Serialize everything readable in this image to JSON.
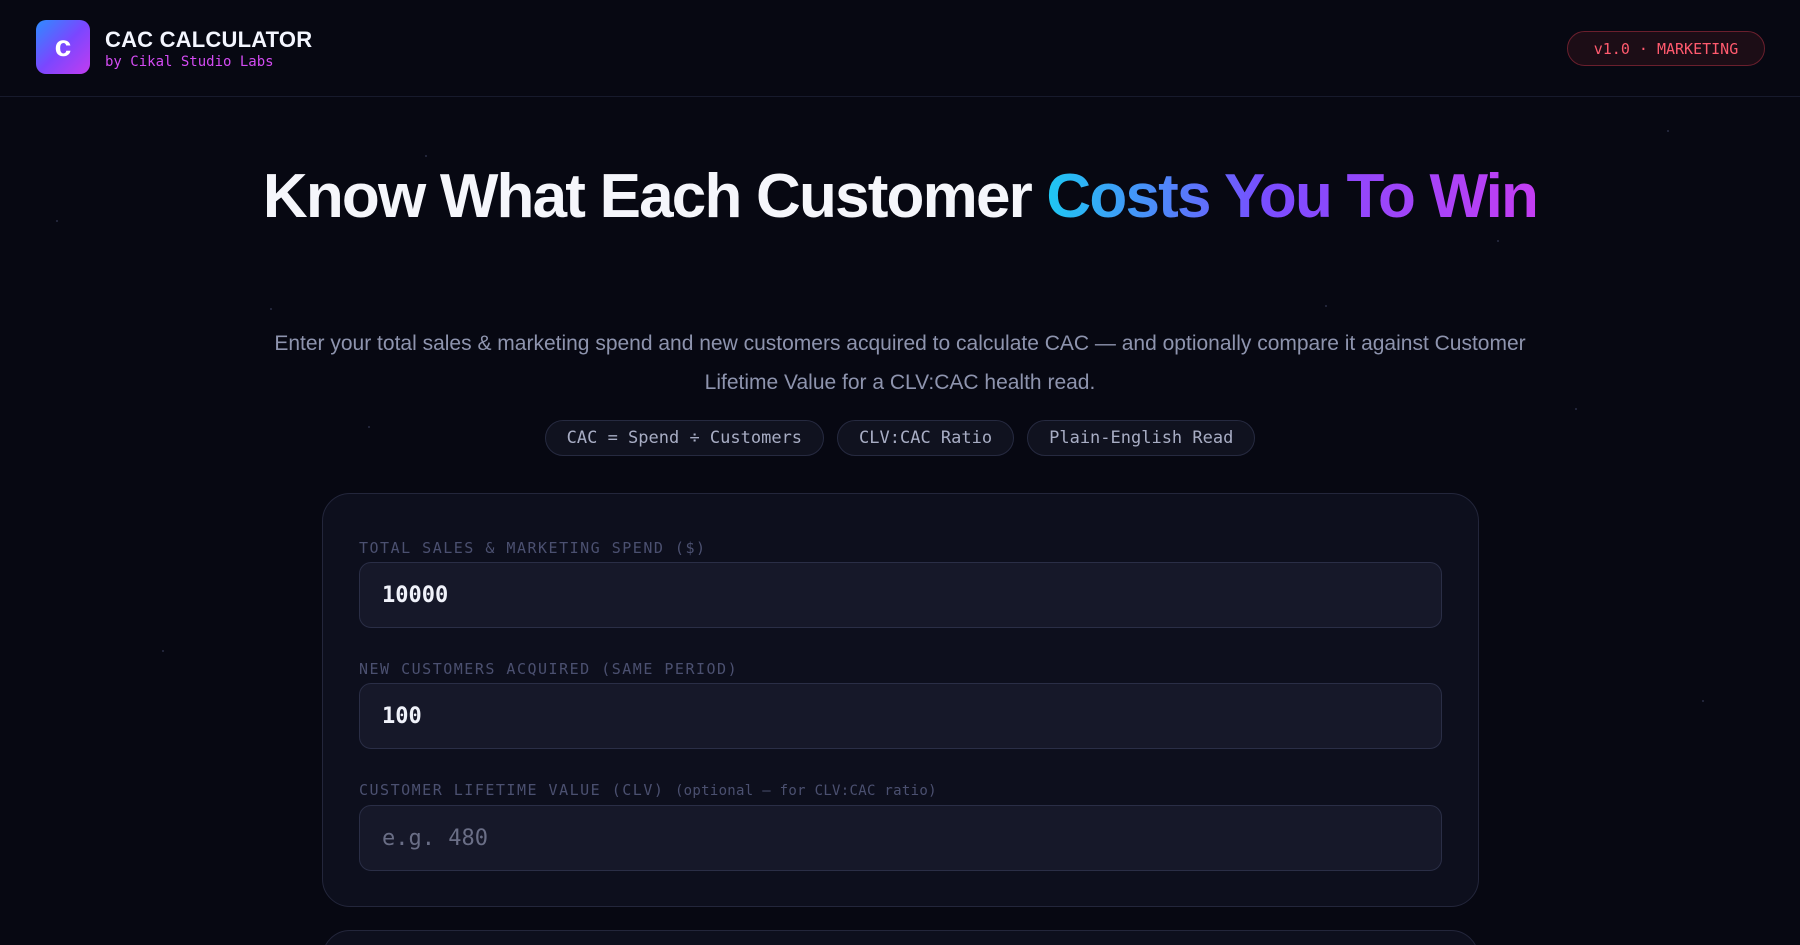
{
  "header": {
    "logo_letter": "c",
    "app_title": "CAC CALCULATOR",
    "app_subtitle": "by Cikal Studio Labs",
    "version_badge": "v1.0 · MARKETING"
  },
  "hero": {
    "title_plain": "Know What Each Customer ",
    "title_accent": "Costs You To Win",
    "subtitle": "Enter your total sales & marketing spend and new customers acquired to calculate CAC — and optionally compare it against Customer Lifetime Value for a CLV:CAC health read.",
    "chips": [
      "CAC = Spend ÷ Customers",
      "CLV:CAC Ratio",
      "Plain-English Read"
    ]
  },
  "form": {
    "spend_label": "TOTAL SALES & MARKETING SPEND ($)",
    "spend_value": "10000",
    "customers_label": "NEW CUSTOMERS ACQUIRED (SAME PERIOD)",
    "customers_value": "100",
    "clv_label": "CUSTOMER LIFETIME VALUE (CLV)",
    "clv_optional_note": "(optional — for CLV:CAC ratio)",
    "clv_value": "",
    "clv_placeholder": "e.g. 480"
  },
  "colors": {
    "background": "#070812",
    "accent_start": "#1ec8f3",
    "accent_end": "#c43df3",
    "badge_red": "#ff5a6e",
    "subtitle_magenta": "#d34bf2"
  }
}
